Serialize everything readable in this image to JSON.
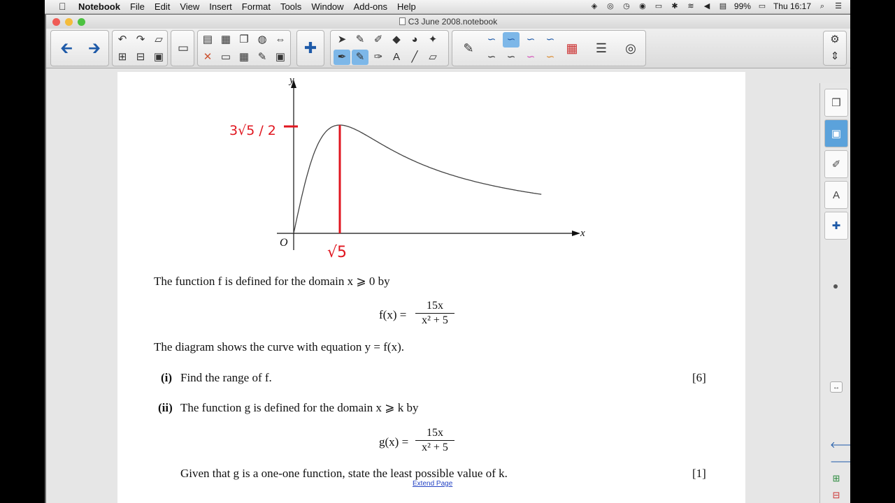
{
  "menubar": {
    "app_name": "Notebook",
    "menus": [
      "File",
      "Edit",
      "View",
      "Insert",
      "Format",
      "Tools",
      "Window",
      "Add-ons",
      "Help"
    ],
    "battery": "99%",
    "clock": "Thu 16:17"
  },
  "window": {
    "title": "C3 June 2008.notebook"
  },
  "document": {
    "graph": {
      "y_label": "y",
      "x_label": "x",
      "origin_label": "O",
      "annotation_max": "3√5 / 2",
      "annotation_sqrt5": "√5"
    },
    "intro": "The function f is defined for the domain x ⩾ 0 by",
    "f_lhs": "f(x) =",
    "f_num": "15x",
    "f_den": "x² + 5",
    "diagram_text": "The diagram shows the curve with equation y = f(x).",
    "q1_num": "(i)",
    "q1_text": "Find the range of f.",
    "q1_marks": "[6]",
    "q2_num": "(ii)",
    "q2_text": "The function g is defined for the domain x ⩾ k by",
    "g_lhs": "g(x) =",
    "g_num": "15x",
    "g_den": "x² + 5",
    "q2b_text": "Given that g is a one-one function, state the least possible value of k.",
    "q2_marks": "[1]",
    "extend_link": "Extend Page"
  },
  "colors": {
    "annotation_red": "#e0161f",
    "active_tab": "#5ba2db"
  }
}
